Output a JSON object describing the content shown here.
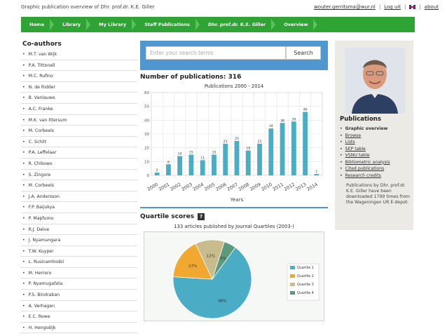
{
  "header": {
    "site_title": "Graphic publication overview of Dhr. prof.dr. K.E. Giller",
    "email": "wouter.gerritsma@wur.nl",
    "logout": "Log uit",
    "about": "about",
    "sep": "|"
  },
  "nav": {
    "items": [
      {
        "label": "Home"
      },
      {
        "label": "Library"
      },
      {
        "label": "My Library"
      },
      {
        "label": "Staff Publications"
      },
      {
        "label": "Dhr. prof.dr. K.E. Giller"
      },
      {
        "label": "Overview"
      }
    ]
  },
  "sidebar": {
    "title": "Co-authors",
    "coauthors": [
      "M.T. van Wijk",
      "P.A. Tittonell",
      "M.C. Rufino",
      "N. de Ridder",
      "B. Vanlauwe",
      "A.C. Franke",
      "M.K. van Ittersum",
      "M. Corbeels",
      "C. Schilt",
      "P.A. Leffelaar",
      "R. Chikowo",
      "S. Zingore",
      "M. Corbeels",
      "J.A. Andersson",
      "F.P. Baijukya",
      "P. Mapfumo",
      "R.J. Delve",
      "J. Nyamangara",
      "T.W. Kuyper",
      "L. Rusinamhodzi",
      "M. Herrero",
      "P. Nyamugafata",
      "P.S. Bindraban",
      "A. Verhagen",
      "E.C. Rowe",
      "H. Hengsdijk"
    ]
  },
  "search": {
    "placeholder": "Enter your search terms",
    "button": "Search"
  },
  "publications": {
    "title": "Number of publications: 316"
  },
  "quartile": {
    "title": "Quartile scores",
    "help": "?"
  },
  "chart_data": [
    {
      "type": "bar",
      "title": "Publications 2000 - 2014",
      "xlabel": "Years",
      "ylabel": "",
      "categories": [
        "2000",
        "2001",
        "2002",
        "2003",
        "2004",
        "2005",
        "2006",
        "2007",
        "2008",
        "2009",
        "2010",
        "2011",
        "2012",
        "2013",
        "2014"
      ],
      "values": [
        2,
        8,
        14,
        15,
        11,
        15,
        23,
        25,
        18,
        23,
        34,
        38,
        39,
        46,
        1
      ],
      "ylim": [
        0,
        60
      ],
      "yticks": [
        "0",
        "10",
        "20",
        "30",
        "40",
        "50",
        "60"
      ],
      "grid": true,
      "color": "#4bacc6"
    },
    {
      "type": "pie",
      "title": "133 articles published by Journal Quartiles (2003-)",
      "slices": [
        {
          "name": "Quartile 1",
          "value": 66,
          "label": "66%",
          "color": "#4bacc6"
        },
        {
          "name": "Quartile 2",
          "value": 17,
          "label": "17%",
          "color": "#f0a830"
        },
        {
          "name": "Quartile 3",
          "value": 12,
          "label": "12%",
          "color": "#c8bc8c"
        },
        {
          "name": "Quartile 4",
          "value": 5,
          "label": "5%",
          "color": "#5c9a7c"
        }
      ],
      "legend": "right"
    }
  ],
  "right_panel": {
    "title": "Publications",
    "links": [
      {
        "label": "Graphic overview",
        "active": true
      },
      {
        "label": "Browse"
      },
      {
        "label": "Lists"
      },
      {
        "label": "SEP table"
      },
      {
        "label": "VSNU table"
      },
      {
        "label": "Bibliometric analysis"
      },
      {
        "label": "Cited publications"
      },
      {
        "label": "Research credits"
      }
    ],
    "note": "Publications by Dhr. prof.dr. K.E. Giller have been downloaded 1799 times from the Wageningen UR E-depot."
  }
}
